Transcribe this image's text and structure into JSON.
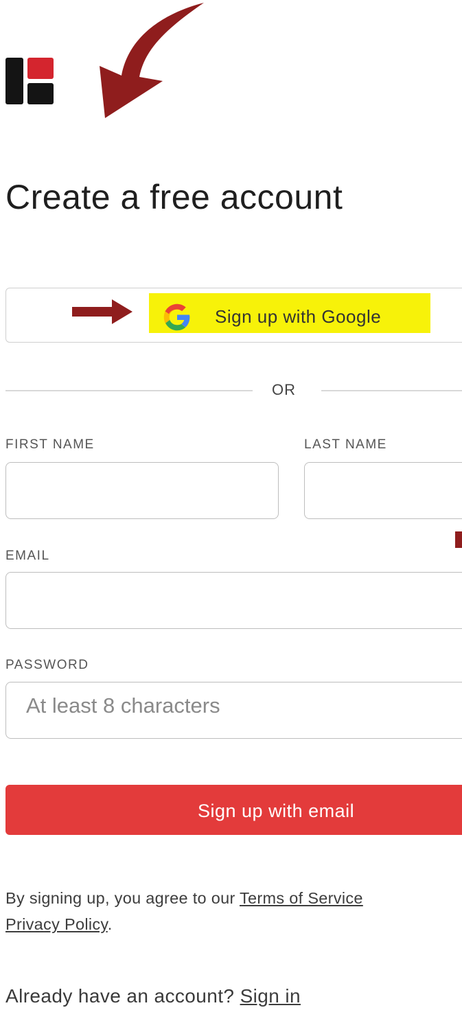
{
  "page": {
    "title": "Create a free account"
  },
  "google_button": {
    "label": "Sign up with Google",
    "icon": "google-g-icon"
  },
  "divider": {
    "label": "OR"
  },
  "form": {
    "first_name_label": "FIRST NAME",
    "first_name_value": "",
    "last_name_label": "LAST NAME",
    "last_name_value": "",
    "email_label": "EMAIL",
    "email_value": "",
    "password_label": "PASSWORD",
    "password_placeholder": "At least 8 characters"
  },
  "submit": {
    "label": "Sign up with email"
  },
  "terms": {
    "prefix": "By signing up, you agree to our ",
    "terms_link": "Terms of Service",
    "privacy_link": "Privacy Policy",
    "suffix": "."
  },
  "signin": {
    "prompt": "Already have an account? ",
    "link": "Sign in"
  },
  "colors": {
    "brand_red": "#d4252e",
    "button_red": "#e33b3b",
    "annotation_arrow": "#8f1d1d",
    "highlight": "#f7f209"
  }
}
